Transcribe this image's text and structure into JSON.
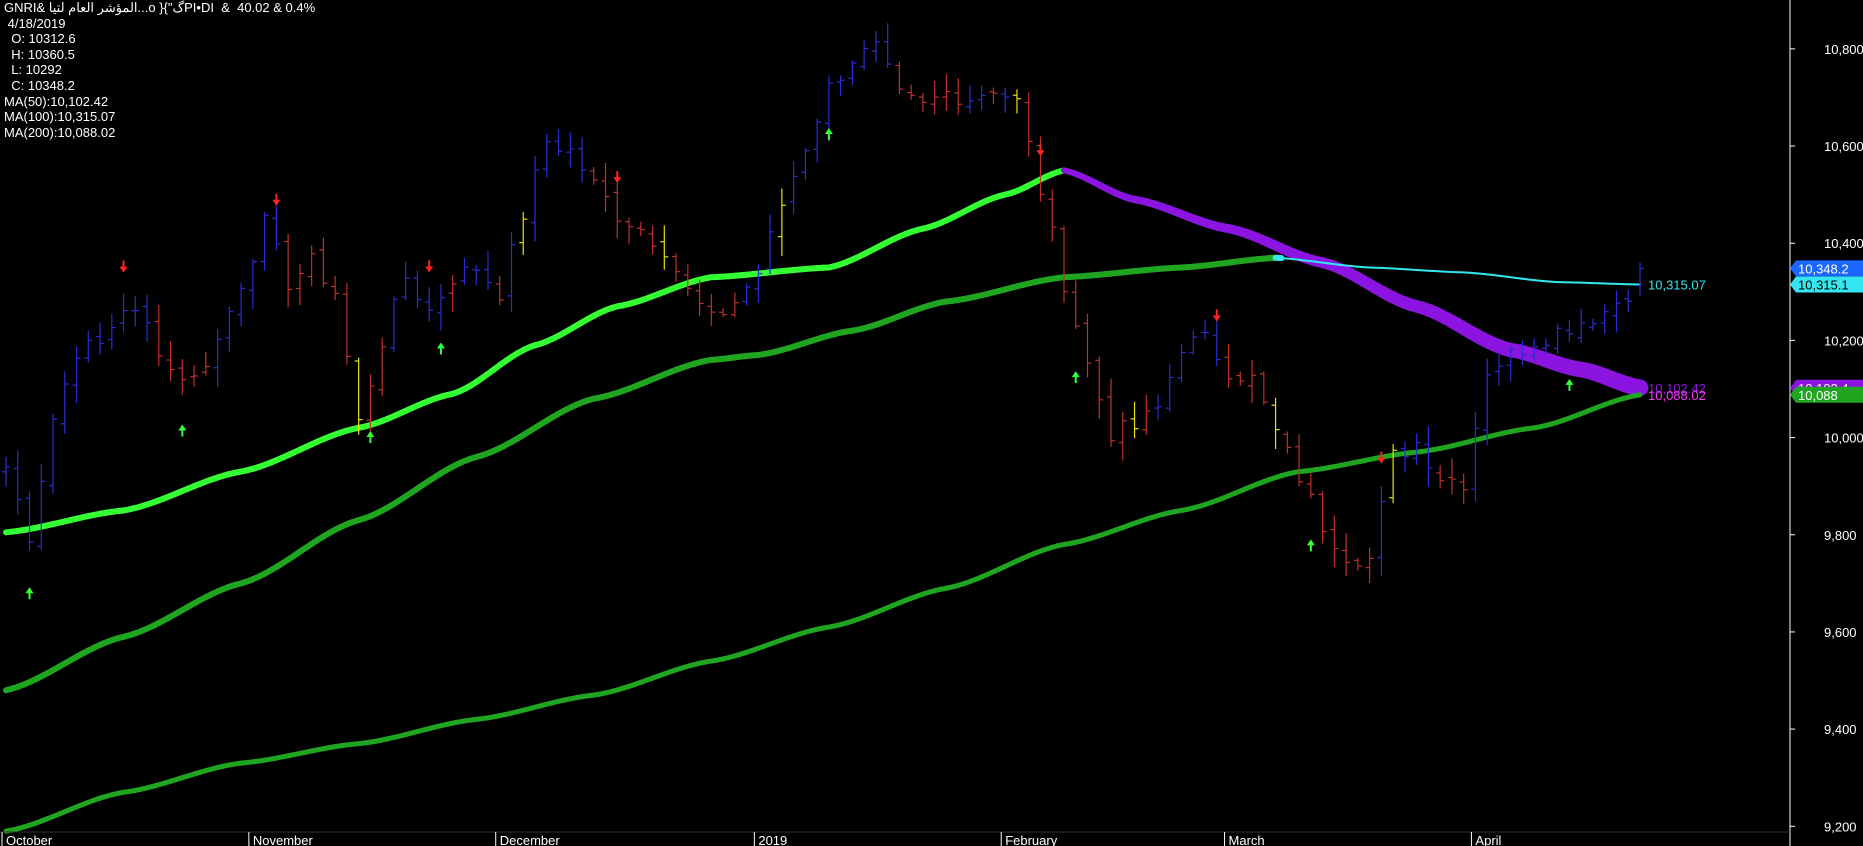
{
  "header": {
    "title": "GNRI& المؤشر العام لتيا...o }{\"گPI•DI  &  40.02 & 0.4%",
    "date": " 4/18/2019",
    "open": "  O: 10312.6",
    "high": "  H: 10360.5",
    "low": "  L: 10292",
    "close": "  C: 10348.2",
    "ma50": "MA(50):10,102.42",
    "ma100": "MA(100):10,315.07",
    "ma200": "MA(200):10,088.02"
  },
  "colors": {
    "background": "#000000",
    "up_bar": "#2b2bd6",
    "down_bar": "#c0312b",
    "neutral_bar": "#e6e600",
    "ma_rising": "#33ff33",
    "ma_green": "#1fa51f",
    "ma_falling": "#8c14e0",
    "ma_cyan": "#33e6f0",
    "buy_arrow": "#33ff33",
    "sell_arrow": "#ff2222"
  },
  "chart_data": {
    "type": "ohlc",
    "ylim": [
      9180,
      10880
    ],
    "yticks": [
      9200,
      9400,
      9600,
      9800,
      10000,
      10200,
      10400,
      10600,
      10800
    ],
    "ytick_labels": [
      "9,200",
      "9,400",
      "9,600",
      "9,800",
      "10,000",
      "10,200",
      "10,400",
      "10,600",
      "10,800"
    ],
    "x_labels": [
      {
        "label": "October",
        "i": 0
      },
      {
        "label": "November",
        "i": 21
      },
      {
        "label": "December",
        "i": 42
      },
      {
        "label": "2019",
        "i": 64
      },
      {
        "label": "February",
        "i": 85
      },
      {
        "label": "March",
        "i": 104
      },
      {
        "label": "April",
        "i": 125
      }
    ],
    "n_bars": 140,
    "key_closes": [
      [
        0,
        9940
      ],
      [
        2,
        9800
      ],
      [
        4,
        10040
      ],
      [
        6,
        10180
      ],
      [
        8,
        10190
      ],
      [
        10,
        10270
      ],
      [
        12,
        10230
      ],
      [
        14,
        10140
      ],
      [
        16,
        10120
      ],
      [
        18,
        10200
      ],
      [
        20,
        10320
      ],
      [
        22,
        10440
      ],
      [
        24,
        10320
      ],
      [
        26,
        10360
      ],
      [
        28,
        10300
      ],
      [
        30,
        10030
      ],
      [
        32,
        10200
      ],
      [
        34,
        10330
      ],
      [
        36,
        10260
      ],
      [
        38,
        10330
      ],
      [
        40,
        10350
      ],
      [
        42,
        10300
      ],
      [
        44,
        10460
      ],
      [
        46,
        10610
      ],
      [
        48,
        10590
      ],
      [
        50,
        10520
      ],
      [
        52,
        10460
      ],
      [
        54,
        10430
      ],
      [
        56,
        10390
      ],
      [
        58,
        10300
      ],
      [
        60,
        10240
      ],
      [
        62,
        10280
      ],
      [
        64,
        10340
      ],
      [
        66,
        10480
      ],
      [
        68,
        10600
      ],
      [
        70,
        10720
      ],
      [
        72,
        10780
      ],
      [
        74,
        10800
      ],
      [
        76,
        10700
      ],
      [
        78,
        10680
      ],
      [
        80,
        10710
      ],
      [
        82,
        10700
      ],
      [
        84,
        10720
      ],
      [
        86,
        10690
      ],
      [
        88,
        10510
      ],
      [
        90,
        10320
      ],
      [
        92,
        10150
      ],
      [
        94,
        10010
      ],
      [
        96,
        10020
      ],
      [
        98,
        10060
      ],
      [
        100,
        10190
      ],
      [
        102,
        10200
      ],
      [
        104,
        10140
      ],
      [
        106,
        10120
      ],
      [
        108,
        10010
      ],
      [
        110,
        9920
      ],
      [
        112,
        9820
      ],
      [
        114,
        9760
      ],
      [
        116,
        9750
      ],
      [
        118,
        9960
      ],
      [
        120,
        9990
      ],
      [
        122,
        9920
      ],
      [
        124,
        9910
      ],
      [
        126,
        10140
      ],
      [
        128,
        10170
      ],
      [
        130,
        10200
      ],
      [
        132,
        10220
      ],
      [
        134,
        10240
      ],
      [
        136,
        10260
      ],
      [
        138,
        10300
      ],
      [
        139,
        10348.2
      ]
    ],
    "last_bar": {
      "open": 10312.6,
      "high": 10360.5,
      "low": 10292,
      "close": 10348.2
    },
    "series": [
      {
        "name": "MA(50)",
        "value": 10102.42,
        "points": [
          [
            0,
            9805
          ],
          [
            10,
            9850
          ],
          [
            20,
            9930
          ],
          [
            30,
            10020
          ],
          [
            38,
            10090
          ],
          [
            45,
            10190
          ],
          [
            52,
            10270
          ],
          [
            60,
            10330
          ],
          [
            70,
            10350
          ],
          [
            78,
            10430
          ],
          [
            85,
            10500
          ],
          [
            90,
            10550
          ],
          [
            96,
            10490
          ],
          [
            104,
            10430
          ],
          [
            112,
            10360
          ],
          [
            120,
            10270
          ],
          [
            128,
            10180
          ],
          [
            134,
            10140
          ],
          [
            139,
            10102.42
          ]
        ],
        "segments": [
          {
            "from": 0,
            "to": 90,
            "color": "#33ff33"
          },
          {
            "from": 90,
            "to": 139,
            "color": "#8c14e0"
          }
        ]
      },
      {
        "name": "MA(100)",
        "value": 10315.07,
        "points": [
          [
            0,
            9480
          ],
          [
            10,
            9590
          ],
          [
            20,
            9700
          ],
          [
            30,
            9830
          ],
          [
            40,
            9960
          ],
          [
            50,
            10080
          ],
          [
            60,
            10160
          ],
          [
            64,
            10170
          ],
          [
            72,
            10220
          ],
          [
            80,
            10280
          ],
          [
            90,
            10330
          ],
          [
            100,
            10350
          ],
          [
            108,
            10370
          ],
          [
            116,
            10350
          ],
          [
            124,
            10340
          ],
          [
            132,
            10320
          ],
          [
            139,
            10315.07
          ]
        ],
        "segments": [
          {
            "from": 0,
            "to": 108,
            "color": "#1fa51f"
          },
          {
            "from": 108,
            "to": 139,
            "color": "#33e6f0"
          }
        ]
      },
      {
        "name": "MA(200)",
        "value": 10088.02,
        "points": [
          [
            0,
            9190
          ],
          [
            10,
            9270
          ],
          [
            20,
            9330
          ],
          [
            30,
            9370
          ],
          [
            40,
            9420
          ],
          [
            50,
            9470
          ],
          [
            60,
            9540
          ],
          [
            70,
            9610
          ],
          [
            80,
            9690
          ],
          [
            90,
            9780
          ],
          [
            100,
            9850
          ],
          [
            110,
            9930
          ],
          [
            120,
            9970
          ],
          [
            130,
            10020
          ],
          [
            139,
            10088.02
          ]
        ],
        "segments": [
          {
            "from": 0,
            "to": 139,
            "color": "#1fa51f"
          }
        ]
      }
    ],
    "buy_signals": [
      2,
      15,
      31,
      37,
      70,
      91,
      111,
      133
    ],
    "sell_signals": [
      10,
      23,
      36,
      52,
      88,
      103,
      117
    ],
    "price_tags": [
      {
        "text": "10,348.2",
        "value": 10348.2,
        "bg": "#1a66ff",
        "fg": "#ffffff"
      },
      {
        "text": "10,315.1",
        "value": 10315.07,
        "bg": "#33e6f0",
        "fg": "#000000"
      },
      {
        "text": "10,102.4",
        "value": 10102.42,
        "bg": "#8c14e0",
        "fg": "#ffffff"
      },
      {
        "text": "10,088",
        "value": 10088.02,
        "bg": "#1fa51f",
        "fg": "#ffffff"
      }
    ],
    "inline_labels": [
      {
        "text": "10,315.07",
        "value": 10315.07,
        "color": "#33e6f0"
      },
      {
        "text": "10,102.42",
        "value": 10102.42,
        "color": "#8c14e0"
      },
      {
        "text": "10,088.02",
        "value": 10088.02,
        "color": "#ff33ff"
      }
    ]
  }
}
